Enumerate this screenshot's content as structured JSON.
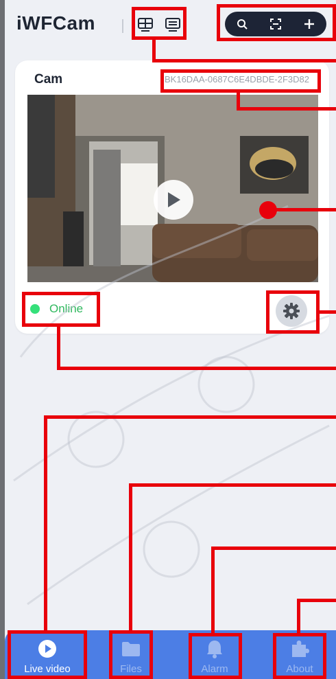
{
  "header": {
    "app_title": "iWFCam",
    "view_icons": [
      "grid-view-icon",
      "list-view-icon"
    ],
    "actions": [
      "search-icon",
      "scan-icon",
      "add-icon"
    ]
  },
  "camera": {
    "name": "Cam",
    "device_id": "BK16DAA-0687C6E4DBDE-2F3D82",
    "status": "Online",
    "status_color": "#35e07a"
  },
  "nav": {
    "items": [
      {
        "label": "Live video",
        "icon": "play-circle-icon",
        "active": true
      },
      {
        "label": "Files",
        "icon": "folder-icon",
        "active": false
      },
      {
        "label": "Alarm",
        "icon": "bell-icon",
        "active": false
      },
      {
        "label": "About",
        "icon": "puzzle-icon",
        "active": false
      }
    ],
    "color": "#4c7ee5"
  },
  "annotation_color": "#e8000b"
}
